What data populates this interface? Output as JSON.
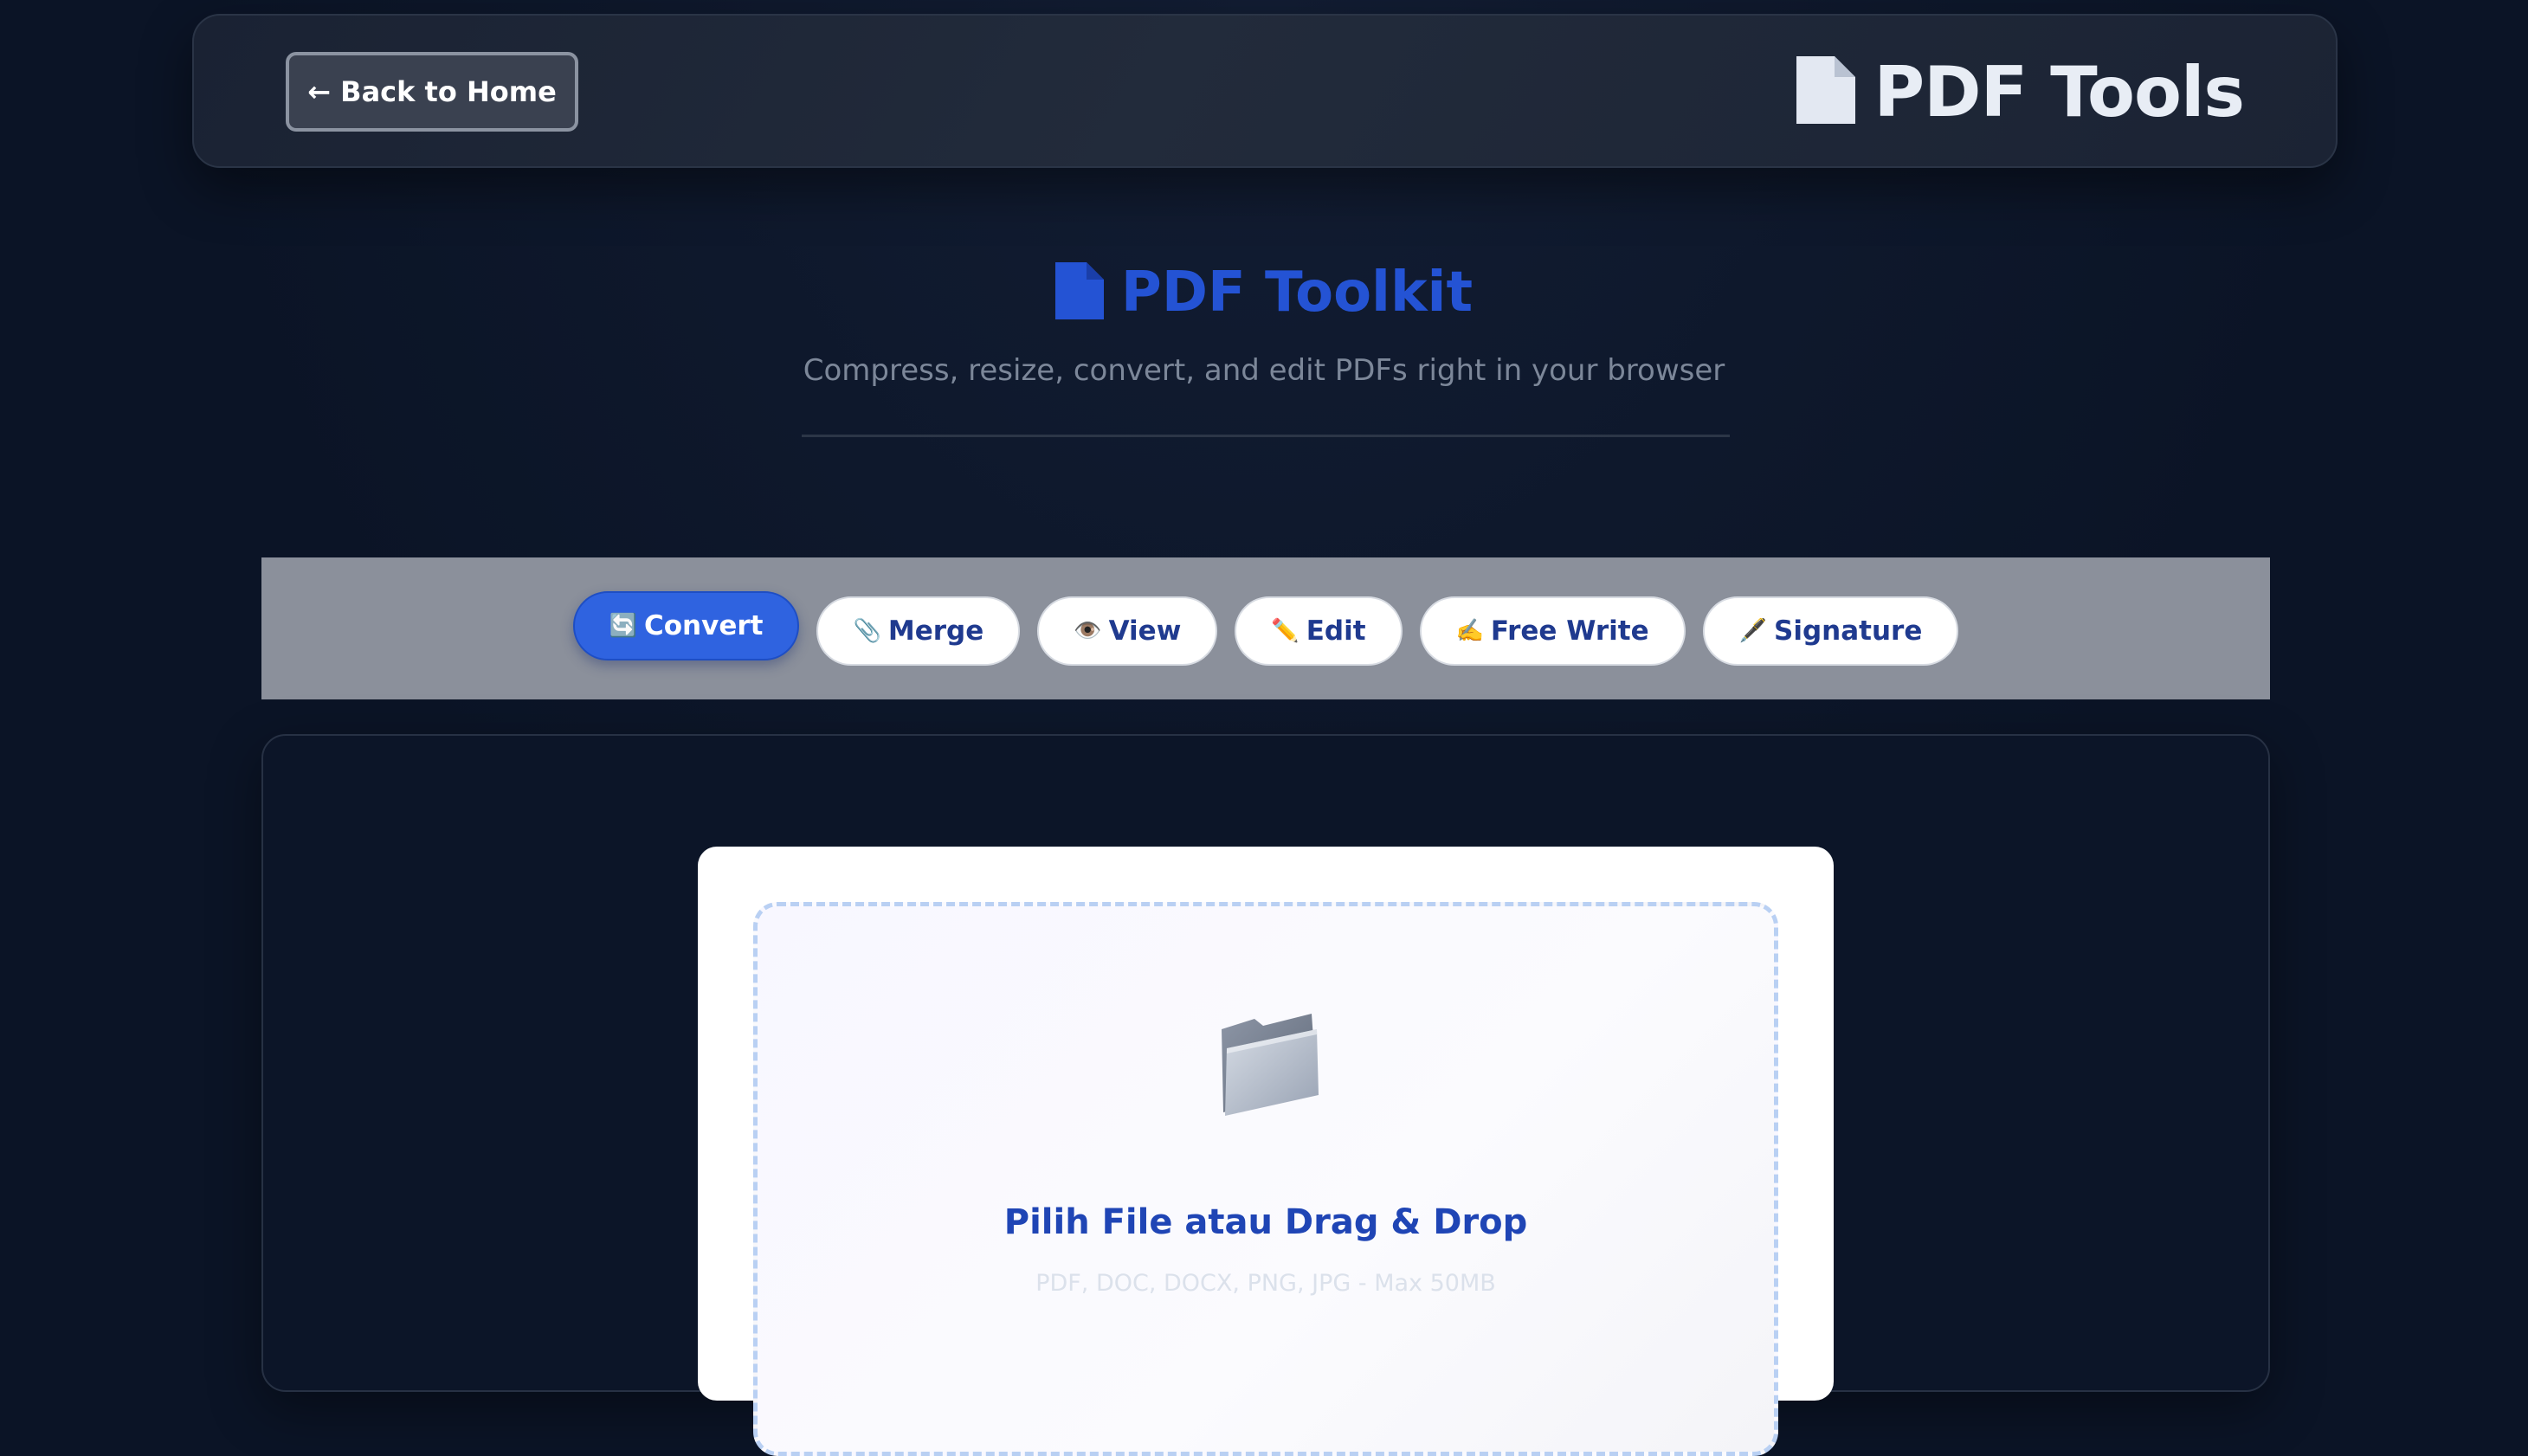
{
  "header": {
    "back_label": "← Back to Home",
    "brand_icon": "document-icon",
    "brand_title": "PDF Tools"
  },
  "hero": {
    "icon": "document-icon",
    "title": "PDF Toolkit",
    "subtitle": "Compress, resize, convert, and edit PDFs right in your browser"
  },
  "tabs": [
    {
      "icon": "🔄",
      "icon_name": "refresh-icon",
      "label": "Convert",
      "active": true
    },
    {
      "icon": "📎",
      "icon_name": "paperclip-icon",
      "label": "Merge",
      "active": false
    },
    {
      "icon": "👁️",
      "icon_name": "eye-icon",
      "label": "View",
      "active": false
    },
    {
      "icon": "✏️",
      "icon_name": "pencil-icon",
      "label": "Edit",
      "active": false
    },
    {
      "icon": "✍️",
      "icon_name": "writing-hand-icon",
      "label": "Free Write",
      "active": false
    },
    {
      "icon": "🖋️",
      "icon_name": "pen-icon",
      "label": "Signature",
      "active": false
    }
  ],
  "upload": {
    "icon": "folder-icon",
    "title": "Pilih File atau Drag & Drop",
    "hint": "PDF, DOC, DOCX, PNG, JPG - Max 50MB"
  },
  "colors": {
    "background": "#0b1426",
    "accent": "#2f63e0",
    "title_blue": "#2453d4",
    "tabs_bar": "#8b909b"
  }
}
